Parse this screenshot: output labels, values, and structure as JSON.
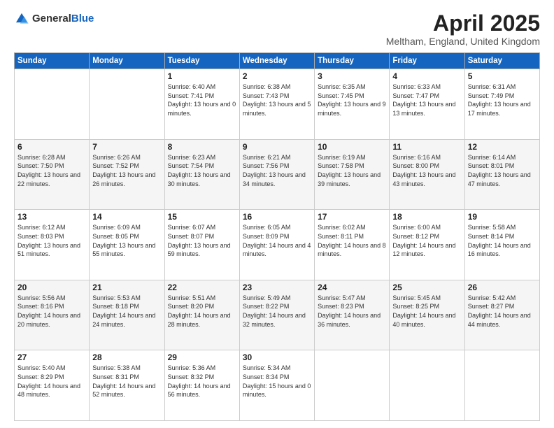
{
  "header": {
    "logo_general": "General",
    "logo_blue": "Blue",
    "title": "April 2025",
    "location": "Meltham, England, United Kingdom"
  },
  "weekdays": [
    "Sunday",
    "Monday",
    "Tuesday",
    "Wednesday",
    "Thursday",
    "Friday",
    "Saturday"
  ],
  "weeks": [
    [
      {
        "day": "",
        "sunrise": "",
        "sunset": "",
        "daylight": ""
      },
      {
        "day": "",
        "sunrise": "",
        "sunset": "",
        "daylight": ""
      },
      {
        "day": "1",
        "sunrise": "Sunrise: 6:40 AM",
        "sunset": "Sunset: 7:41 PM",
        "daylight": "Daylight: 13 hours and 0 minutes."
      },
      {
        "day": "2",
        "sunrise": "Sunrise: 6:38 AM",
        "sunset": "Sunset: 7:43 PM",
        "daylight": "Daylight: 13 hours and 5 minutes."
      },
      {
        "day": "3",
        "sunrise": "Sunrise: 6:35 AM",
        "sunset": "Sunset: 7:45 PM",
        "daylight": "Daylight: 13 hours and 9 minutes."
      },
      {
        "day": "4",
        "sunrise": "Sunrise: 6:33 AM",
        "sunset": "Sunset: 7:47 PM",
        "daylight": "Daylight: 13 hours and 13 minutes."
      },
      {
        "day": "5",
        "sunrise": "Sunrise: 6:31 AM",
        "sunset": "Sunset: 7:49 PM",
        "daylight": "Daylight: 13 hours and 17 minutes."
      }
    ],
    [
      {
        "day": "6",
        "sunrise": "Sunrise: 6:28 AM",
        "sunset": "Sunset: 7:50 PM",
        "daylight": "Daylight: 13 hours and 22 minutes."
      },
      {
        "day": "7",
        "sunrise": "Sunrise: 6:26 AM",
        "sunset": "Sunset: 7:52 PM",
        "daylight": "Daylight: 13 hours and 26 minutes."
      },
      {
        "day": "8",
        "sunrise": "Sunrise: 6:23 AM",
        "sunset": "Sunset: 7:54 PM",
        "daylight": "Daylight: 13 hours and 30 minutes."
      },
      {
        "day": "9",
        "sunrise": "Sunrise: 6:21 AM",
        "sunset": "Sunset: 7:56 PM",
        "daylight": "Daylight: 13 hours and 34 minutes."
      },
      {
        "day": "10",
        "sunrise": "Sunrise: 6:19 AM",
        "sunset": "Sunset: 7:58 PM",
        "daylight": "Daylight: 13 hours and 39 minutes."
      },
      {
        "day": "11",
        "sunrise": "Sunrise: 6:16 AM",
        "sunset": "Sunset: 8:00 PM",
        "daylight": "Daylight: 13 hours and 43 minutes."
      },
      {
        "day": "12",
        "sunrise": "Sunrise: 6:14 AM",
        "sunset": "Sunset: 8:01 PM",
        "daylight": "Daylight: 13 hours and 47 minutes."
      }
    ],
    [
      {
        "day": "13",
        "sunrise": "Sunrise: 6:12 AM",
        "sunset": "Sunset: 8:03 PM",
        "daylight": "Daylight: 13 hours and 51 minutes."
      },
      {
        "day": "14",
        "sunrise": "Sunrise: 6:09 AM",
        "sunset": "Sunset: 8:05 PM",
        "daylight": "Daylight: 13 hours and 55 minutes."
      },
      {
        "day": "15",
        "sunrise": "Sunrise: 6:07 AM",
        "sunset": "Sunset: 8:07 PM",
        "daylight": "Daylight: 13 hours and 59 minutes."
      },
      {
        "day": "16",
        "sunrise": "Sunrise: 6:05 AM",
        "sunset": "Sunset: 8:09 PM",
        "daylight": "Daylight: 14 hours and 4 minutes."
      },
      {
        "day": "17",
        "sunrise": "Sunrise: 6:02 AM",
        "sunset": "Sunset: 8:11 PM",
        "daylight": "Daylight: 14 hours and 8 minutes."
      },
      {
        "day": "18",
        "sunrise": "Sunrise: 6:00 AM",
        "sunset": "Sunset: 8:12 PM",
        "daylight": "Daylight: 14 hours and 12 minutes."
      },
      {
        "day": "19",
        "sunrise": "Sunrise: 5:58 AM",
        "sunset": "Sunset: 8:14 PM",
        "daylight": "Daylight: 14 hours and 16 minutes."
      }
    ],
    [
      {
        "day": "20",
        "sunrise": "Sunrise: 5:56 AM",
        "sunset": "Sunset: 8:16 PM",
        "daylight": "Daylight: 14 hours and 20 minutes."
      },
      {
        "day": "21",
        "sunrise": "Sunrise: 5:53 AM",
        "sunset": "Sunset: 8:18 PM",
        "daylight": "Daylight: 14 hours and 24 minutes."
      },
      {
        "day": "22",
        "sunrise": "Sunrise: 5:51 AM",
        "sunset": "Sunset: 8:20 PM",
        "daylight": "Daylight: 14 hours and 28 minutes."
      },
      {
        "day": "23",
        "sunrise": "Sunrise: 5:49 AM",
        "sunset": "Sunset: 8:22 PM",
        "daylight": "Daylight: 14 hours and 32 minutes."
      },
      {
        "day": "24",
        "sunrise": "Sunrise: 5:47 AM",
        "sunset": "Sunset: 8:23 PM",
        "daylight": "Daylight: 14 hours and 36 minutes."
      },
      {
        "day": "25",
        "sunrise": "Sunrise: 5:45 AM",
        "sunset": "Sunset: 8:25 PM",
        "daylight": "Daylight: 14 hours and 40 minutes."
      },
      {
        "day": "26",
        "sunrise": "Sunrise: 5:42 AM",
        "sunset": "Sunset: 8:27 PM",
        "daylight": "Daylight: 14 hours and 44 minutes."
      }
    ],
    [
      {
        "day": "27",
        "sunrise": "Sunrise: 5:40 AM",
        "sunset": "Sunset: 8:29 PM",
        "daylight": "Daylight: 14 hours and 48 minutes."
      },
      {
        "day": "28",
        "sunrise": "Sunrise: 5:38 AM",
        "sunset": "Sunset: 8:31 PM",
        "daylight": "Daylight: 14 hours and 52 minutes."
      },
      {
        "day": "29",
        "sunrise": "Sunrise: 5:36 AM",
        "sunset": "Sunset: 8:32 PM",
        "daylight": "Daylight: 14 hours and 56 minutes."
      },
      {
        "day": "30",
        "sunrise": "Sunrise: 5:34 AM",
        "sunset": "Sunset: 8:34 PM",
        "daylight": "Daylight: 15 hours and 0 minutes."
      },
      {
        "day": "",
        "sunrise": "",
        "sunset": "",
        "daylight": ""
      },
      {
        "day": "",
        "sunrise": "",
        "sunset": "",
        "daylight": ""
      },
      {
        "day": "",
        "sunrise": "",
        "sunset": "",
        "daylight": ""
      }
    ]
  ]
}
